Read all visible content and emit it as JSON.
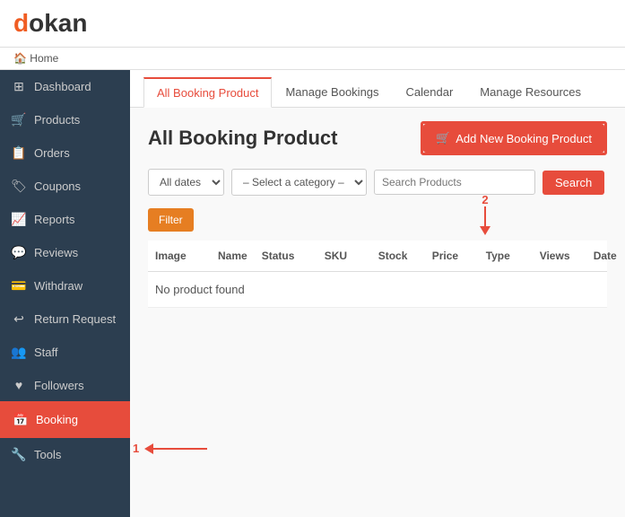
{
  "logo": {
    "text_d": "d",
    "text_okan": "okan"
  },
  "breadcrumb": {
    "home_label": "Home"
  },
  "sidebar": {
    "items": [
      {
        "id": "dashboard",
        "label": "Dashboard",
        "icon": "⊞"
      },
      {
        "id": "products",
        "label": "Products",
        "icon": "🛒"
      },
      {
        "id": "orders",
        "label": "Orders",
        "icon": "📋"
      },
      {
        "id": "coupons",
        "label": "Coupons",
        "icon": "🏷"
      },
      {
        "id": "reports",
        "label": "Reports",
        "icon": "📈"
      },
      {
        "id": "reviews",
        "label": "Reviews",
        "icon": "💬"
      },
      {
        "id": "withdraw",
        "label": "Withdraw",
        "icon": "💳"
      },
      {
        "id": "return-request",
        "label": "Return Request",
        "icon": "↩"
      },
      {
        "id": "staff",
        "label": "Staff",
        "icon": "👥"
      },
      {
        "id": "followers",
        "label": "Followers",
        "icon": "♥"
      },
      {
        "id": "booking",
        "label": "Booking",
        "icon": "📅",
        "active": true
      },
      {
        "id": "tools",
        "label": "Tools",
        "icon": "🔧"
      }
    ]
  },
  "tabs": [
    {
      "id": "all-booking-product",
      "label": "All Booking Product",
      "active": true
    },
    {
      "id": "manage-bookings",
      "label": "Manage Bookings",
      "active": false
    },
    {
      "id": "calendar",
      "label": "Calendar",
      "active": false
    },
    {
      "id": "manage-resources",
      "label": "Manage Resources",
      "active": false
    }
  ],
  "page": {
    "title": "All Booking Product",
    "add_button_label": "Add New Booking Product",
    "add_button_icon": "🛒"
  },
  "filters": {
    "dates_label": "All dates",
    "category_placeholder": "– Select a category –",
    "search_placeholder": "Search Products",
    "search_button_label": "Search",
    "filter_button_label": "Filter"
  },
  "table": {
    "columns": [
      "Image",
      "Name",
      "Status",
      "SKU",
      "Stock",
      "Price",
      "Type",
      "Views",
      "Date"
    ],
    "empty_message": "No product found"
  },
  "annotations": {
    "arrow1_label": "1",
    "arrow2_label": "2"
  }
}
